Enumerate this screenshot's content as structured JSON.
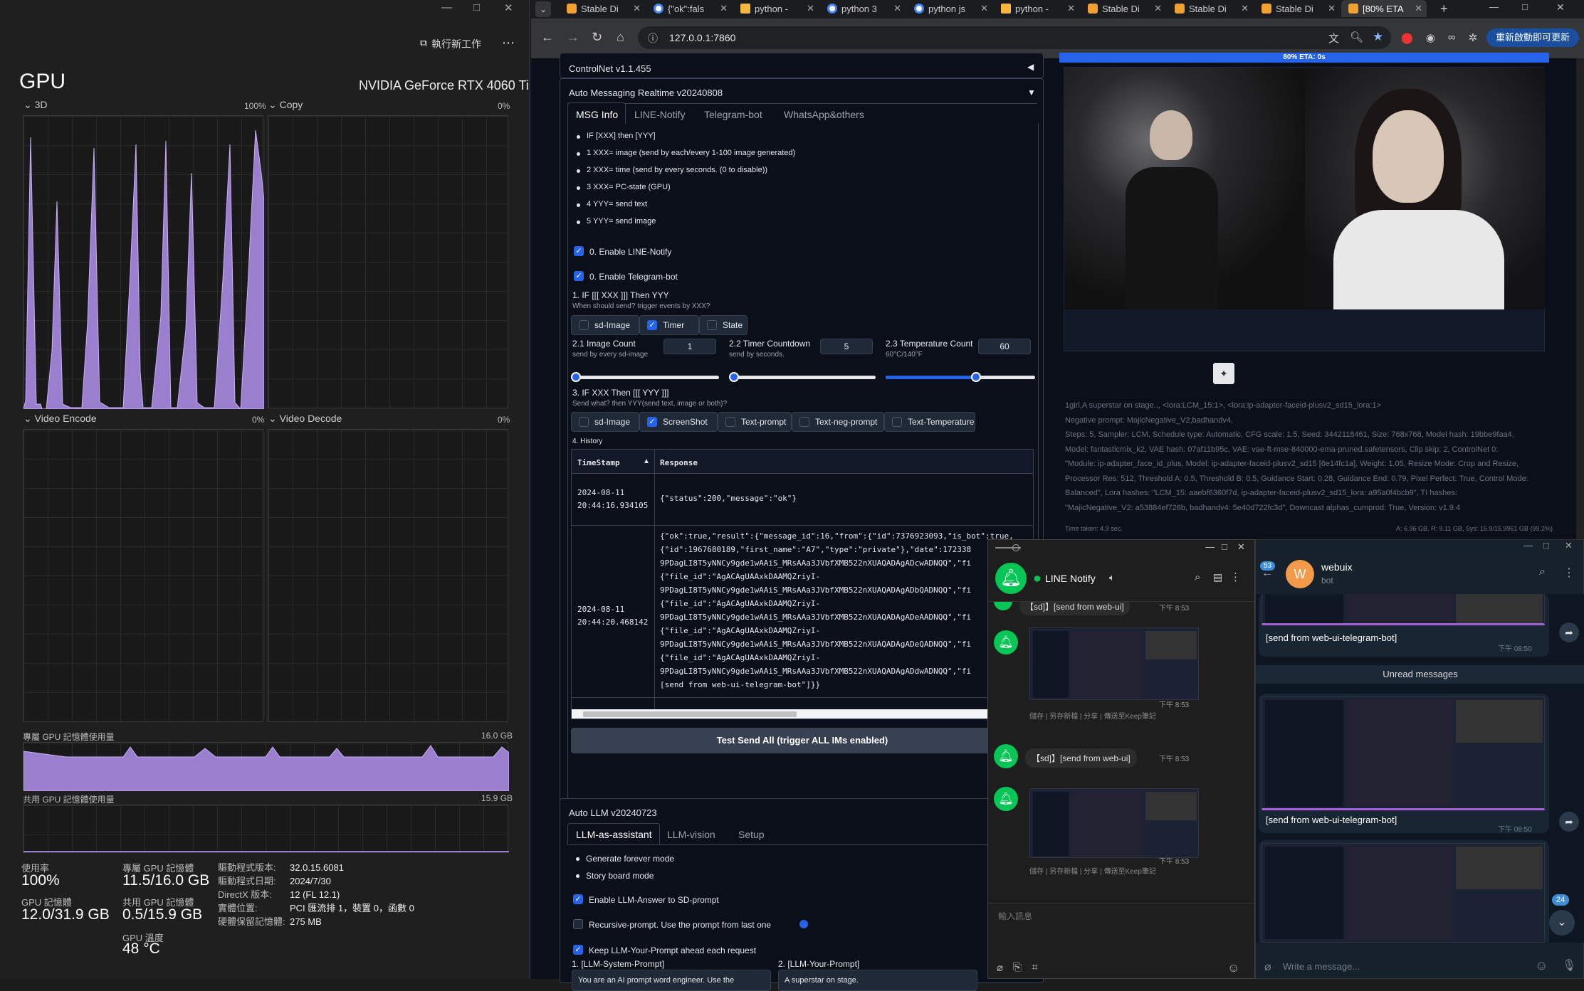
{
  "taskmgr": {
    "run_task": "執行新工作",
    "menu": "⋯",
    "title": "GPU",
    "gpu_name": "NVIDIA GeForce RTX 4060 Ti",
    "e3d": "3D",
    "e3d_pct": "100%",
    "copy": "Copy",
    "copy_pct": "0%",
    "venc": "Video Encode",
    "venc_pct": "0%",
    "vdec": "Video Decode",
    "vdec_pct": "0%",
    "ded_mem_label": "專屬 GPU 記憶體使用量",
    "ded_mem_max": "16.0 GB",
    "shared_mem_label": "共用 GPU 記憶體使用量",
    "shared_mem_max": "15.9 GB",
    "util_label": "使用率",
    "util_val": "100%",
    "gpu_mem_label": "GPU 記憶體",
    "gpu_mem_val": "12.0/31.9 GB",
    "ded_label": "專屬 GPU 記憶體",
    "ded_val": "11.5/16.0 GB",
    "sh_label": "共用 GPU 記憶體",
    "sh_val": "0.5/15.9 GB",
    "temp_label": "GPU 溫度",
    "temp_val": "48 °C",
    "drv_ver_l": "驅動程式版本:",
    "drv_ver": "32.0.15.6081",
    "drv_date_l": "驅動程式日期:",
    "drv_date": "2024/7/30",
    "dx_l": "DirectX 版本:",
    "dx": "12 (FL 12.1)",
    "loc_l": "實體位置:",
    "loc": "PCI 匯流排 1，裝置 0，函數 0",
    "hwres_l": "硬體保留記憶體:",
    "hwres": "275 MB"
  },
  "browser": {
    "tabs": [
      "Stable Di",
      "{\"ok\":fals",
      "python -",
      "python 3",
      "python js",
      "python -",
      "Stable Di",
      "Stable Di",
      "Stable Di",
      "[80% ETA"
    ],
    "url": "127.0.0.1:7860",
    "update_btn": "重新啟動即可更新"
  },
  "webui": {
    "controlnet": "ControlNet v1.1.455",
    "am_title": "Auto Messaging Realtime v20240808",
    "am_tabs": [
      "MSG Info",
      "LINE-Notify",
      "Telegram-bot",
      "WhatsApp&others"
    ],
    "info": [
      "IF [XXX] then [YYY]",
      "1 XXX= image (send by each/every 1-100 image generated)",
      "2 XXX= time (send by every seconds. (0 to disable))",
      "3 XXX= PC-state (GPU)",
      "4 YYY= send text",
      "5 YYY= send image"
    ],
    "en_line": "0. Enable LINE-Notify",
    "en_tg": "0. Enable Telegram-bot",
    "if_title": "1. IF [[[ XXX ]]] Then YYY",
    "if_sub": "When should send? trigger events by XXX?",
    "trig": [
      "sd-Image",
      "Timer",
      "State"
    ],
    "ic_l": "2.1 Image Count",
    "ic_s": "send by every sd-image",
    "ic_v": "1",
    "tc_l": "2.2 Timer Countdown",
    "tc_s": "send by seconds.",
    "tc_v": "5",
    "tp_l": "2.3 Temperature Count",
    "tp_s": "60°C/140°F",
    "tp_v": "60",
    "then_title": "3. IF XXX Then [[[ YYY ]]]",
    "then_sub": "Send what? then YYY(send text, image or both)?",
    "send": [
      "sd-Image",
      "ScreenShot",
      "Text-prompt",
      "Text-neg-prompt",
      "Text-Temperature"
    ],
    "hist": "4. History",
    "col_ts": "TimeStamp",
    "col_resp": "Response",
    "row1_ts": "2024-08-11\n20:44:16.934105",
    "row1_resp": "{\"status\":200,\"message\":\"ok\"}",
    "row2_ts": "2024-08-11\n20:44:20.468142",
    "row2_resp": "{\"ok\":true,\"result\":{\"message_id\":16,\"from\":{\"id\":7376923093,\"is_bot\":true,\n{\"id\":1967680189,\"first_name\":\"A7\",\"type\":\"private\"},\"date\":172338\n9PDagLI8T5yNNCy9gde1wAAiS_MRsAAa3JVbfXMB522nXUAQADAgADcwADNQQ\",\"fi\n{\"file_id\":\"AgACAgUAAxkDAAMQZriyI-\n9PDagLI8T5yNNCy9gde1wAAiS_MRsAAa3JVbfXMB522nXUAQADAgADbQADNQQ\",\"fi\n{\"file_id\":\"AgACAgUAAxkDAAMQZriyI-\n9PDagLI8T5yNNCy9gde1wAAiS_MRsAAa3JVbfXMB522nXUAQADAgADeAADNQQ\",\"fi\n{\"file_id\":\"AgACAgUAAxkDAAMQZriyI-\n9PDagLI8T5yNNCy9gde1wAAiS_MRsAAa3JVbfXMB522nXUAQADAgADeQADNQQ\",\"fi\n{\"file_id\":\"AgACAgUAAxkDAAMQZriyI-\n9PDagLI8T5yNNCy9gde1wAAiS_MRsAAa3JVbfXMB522nXUAQADAgADdwADNQQ\",\"fi\n[send from web-ui-telegram-bot\"]}}",
    "test_btn": "Test Send All (trigger ALL IMs enabled)",
    "llm_title": "Auto LLM v20240723",
    "llm_tabs": [
      "LLM-as-assistant",
      "LLM-vision",
      "Setup"
    ],
    "llm_modes": [
      "Generate forever mode",
      "Story board mode"
    ],
    "llm_c1": "Enable LLM-Answer to SD-prompt",
    "llm_c2": "Recursive-prompt. Use the prompt from last one",
    "llm_c3": "Keep LLM-Your-Prompt ahead each request",
    "sys_l": "1. [LLM-System-Prompt]",
    "your_l": "2. [LLM-Your-Prompt]",
    "sys_v": "You are an AI prompt word engineer. Use the",
    "your_v": "A superstar on stage.",
    "eta": "80% ETA: 0s",
    "gen_info": "1girl,A superstar on stage.,, <lora:LCM_15:1>, <lora:ip-adapter-faceid-plusv2_sd15_lora:1>\nNegative prompt: MajicNegative_V2,badhandv4,\nSteps: 5, Sampler: LCM, Schedule type: Automatic, CFG scale: 1.5, Seed: 3442118461, Size: 768x768, Model hash: 19bbe9faa4,\nModel: fantasticmix_k2, VAE hash: 07af11b95c, VAE: vae-ft-mse-840000-ema-pruned.safetensors, Clip skip: 2, ControlNet 0:\n\"Module: ip-adapter_face_id_plus, Model: ip-adapter-faceid-plusv2_sd15 [6e14fc1a], Weight: 1.05, Resize Mode: Crop and Resize,\nProcessor Res: 512, Threshold A: 0.5, Threshold B: 0.5, Guidance Start: 0.28, Guidance End: 0.79, Pixel Perfect: True, Control Mode:\nBalanced\", Lora hashes: \"LCM_15: aaebf6360f7d, ip-adapter-faceid-plusv2_sd15_lora: a95a0f4bcb9\", TI hashes:\n\"MajicNegative_V2: a53884ef726b, badhandv4: 5e40d722fc3d\", Downcast alphas_cumprod: True, Version: v1.9.4",
    "time_taken": "Time taken: 4.9 sec.",
    "vram": "A: 6.96 GB, R: 9.11 GB, Sys: 15.9/15.9961 GB (99.2%)"
  },
  "line": {
    "title": "LINE Notify",
    "msg_sd": "【sd]】[send from web-ui]",
    "t1": "下午 8:53",
    "actions": "儲存 | 另存新檔 | 分享 | 傳送至Keep筆記",
    "input_ph": "輸入訊息"
  },
  "tg": {
    "badge": "53",
    "name": "webuix",
    "sub": "bot",
    "msg": "[send from web-ui-telegram-bot]",
    "t": "下午 08:50",
    "unread": "Unread messages",
    "count": "24",
    "input_ph": "Write a message..."
  }
}
